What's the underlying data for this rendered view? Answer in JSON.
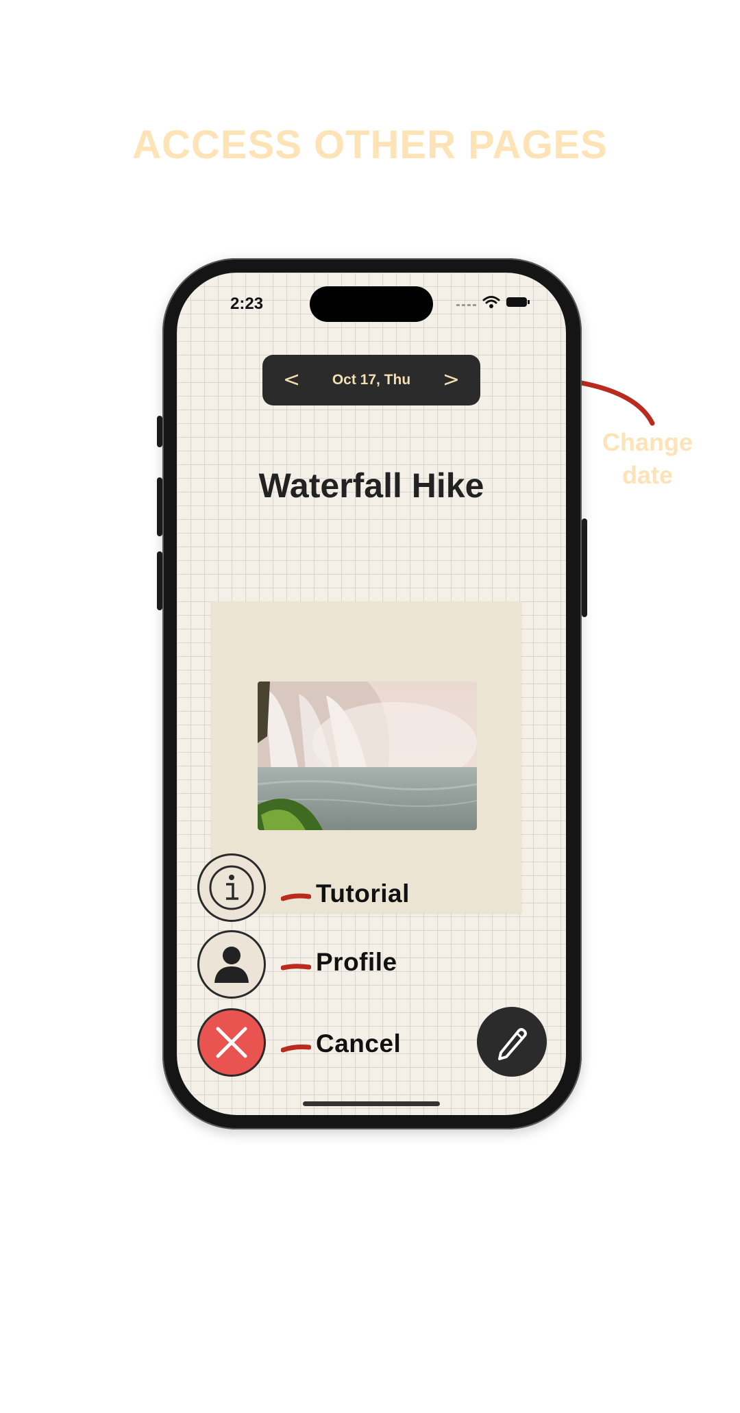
{
  "headline": "ACCESS OTHER PAGES",
  "annotation": {
    "line1": "Change",
    "line2": "date"
  },
  "status_bar": {
    "time": "2:23"
  },
  "date_nav": {
    "prev": "<",
    "date": "Oct 17, Thu",
    "next": ">"
  },
  "entry": {
    "title": "Waterfall Hike"
  },
  "menu": [
    {
      "label": "Tutorial",
      "icon": "info-icon"
    },
    {
      "label": "Profile",
      "icon": "person-icon"
    },
    {
      "label": "Cancel",
      "icon": "close-icon"
    }
  ],
  "edit_button": {
    "icon": "pencil-icon"
  },
  "colors": {
    "headline": "#fde3b5",
    "pill_bg": "#2b2b2b",
    "pill_text": "#f3dfb3",
    "cancel": "#ea5450",
    "accent_red": "#b92b1f"
  }
}
